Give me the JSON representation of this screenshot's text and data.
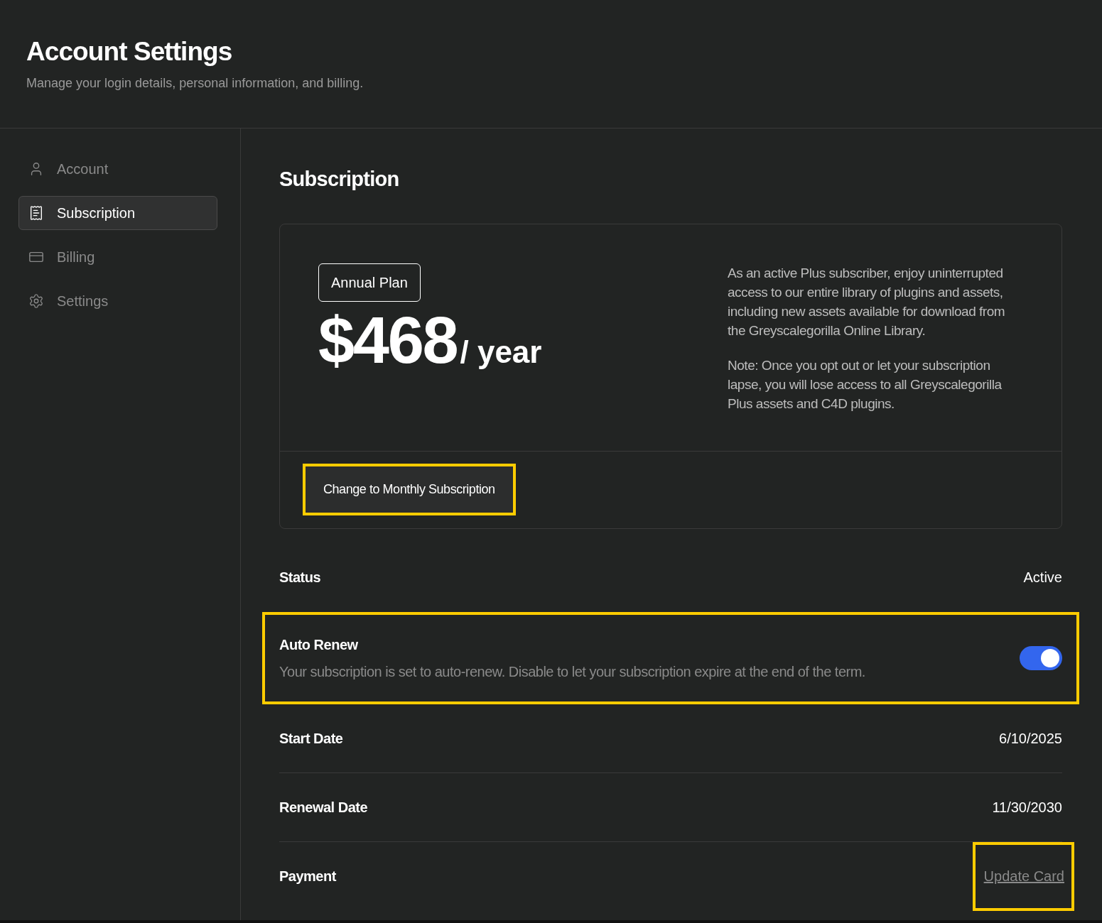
{
  "header": {
    "title": "Account Settings",
    "subtitle": "Manage your login details, personal information, and billing."
  },
  "sidebar": {
    "items": [
      {
        "label": "Account",
        "selected": false
      },
      {
        "label": "Subscription",
        "selected": true
      },
      {
        "label": "Billing",
        "selected": false
      },
      {
        "label": "Settings",
        "selected": false
      }
    ]
  },
  "section_title": "Subscription",
  "plan_card": {
    "badge": "Annual Plan",
    "price": "$468",
    "period": "/ year",
    "description": "As an active Plus subscriber, enjoy uninterrupted access to our entire library of plugins and assets, including new assets available for download from the Greyscalegorilla Online Library.",
    "note": "Note: Once you opt out or let your subscription lapse, you will lose access to all Greyscalegorilla Plus assets and C4D plugins.",
    "button": {
      "label": "Change to Monthly Subscription",
      "highlighted": true
    }
  },
  "rows": [
    {
      "kind": "value",
      "label": "Status",
      "value": "Active",
      "highlighted": false
    },
    {
      "kind": "toggle",
      "label": "Auto Renew",
      "description": "Your subscription is set to auto-renew. Disable to let your subscription expire at the end of the term.",
      "on": true,
      "highlighted": true
    },
    {
      "kind": "date",
      "label": "Start Date",
      "value": "6/10/2025",
      "highlighted": false
    },
    {
      "kind": "date",
      "label": "Renewal Date",
      "value": "11/30/2030",
      "highlighted": false
    },
    {
      "kind": "link",
      "label": "Payment",
      "value": "Update Card",
      "highlighted": true
    }
  ]
}
